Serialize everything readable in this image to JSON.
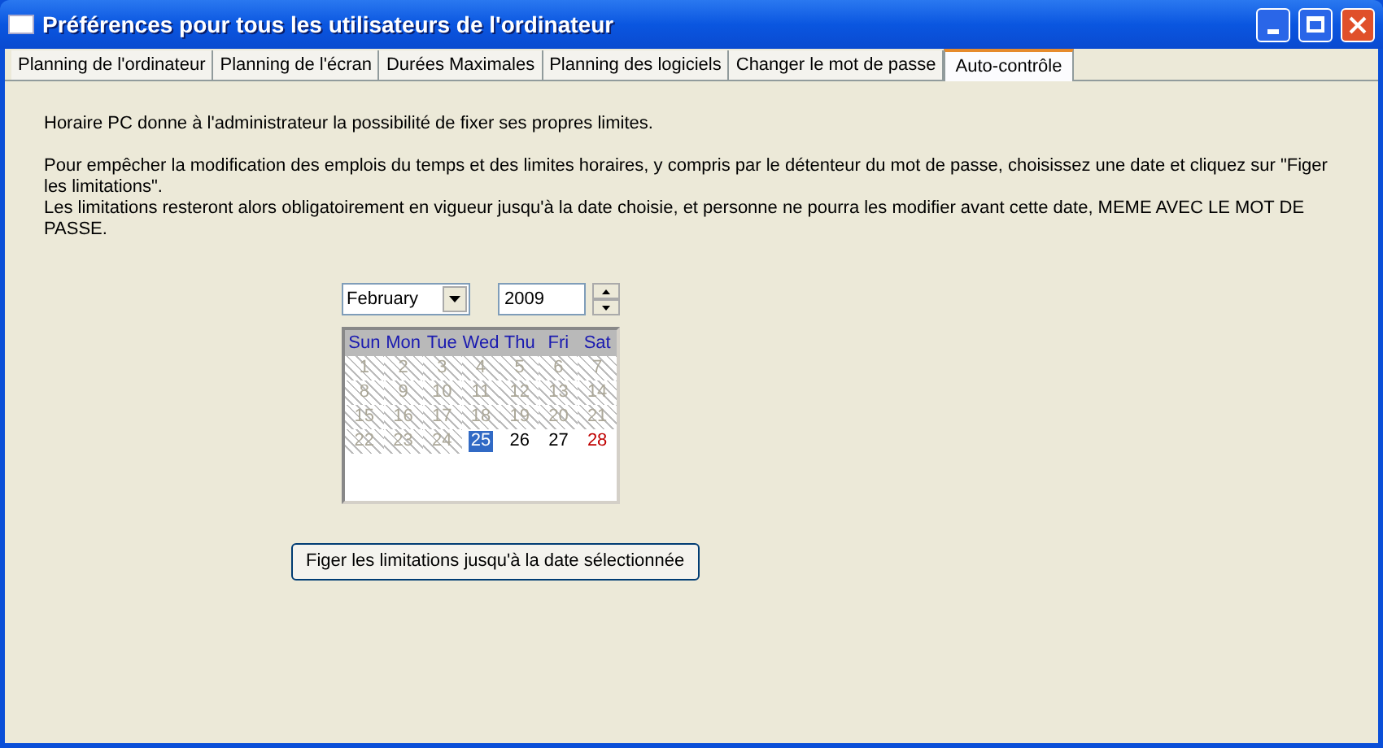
{
  "window": {
    "title": "Préférences pour tous les utilisateurs de l'ordinateur"
  },
  "tabs": [
    {
      "label": "Planning de l'ordinateur",
      "selected": false
    },
    {
      "label": "Planning de l'écran",
      "selected": false
    },
    {
      "label": "Durées Maximales",
      "selected": false
    },
    {
      "label": "Planning des logiciels",
      "selected": false
    },
    {
      "label": "Changer le mot de passe",
      "selected": false
    },
    {
      "label": "Auto-contrôle",
      "selected": true
    }
  ],
  "intro": "Horaire PC donne à l'administrateur la possibilité de fixer ses propres limites.",
  "paragraphs": [
    "Pour empêcher la modification des emplois du temps et des limites horaires, y compris par le détenteur du mot de passe, choisissez une date et cliquez sur \"Figer les limitations\".",
    "Les limitations resteront alors obligatoirement en vigueur jusqu'à la date choisie, et personne ne pourra les modifier avant cette date, MEME AVEC LE MOT DE PASSE."
  ],
  "month_select": {
    "value": "February"
  },
  "year_field": {
    "value": "2009"
  },
  "calendar": {
    "weekdays": [
      "Sun",
      "Mon",
      "Tue",
      "Wed",
      "Thu",
      "Fri",
      "Sat"
    ],
    "weeks": [
      [
        {
          "day": "1",
          "kind": "disabled"
        },
        {
          "day": "2",
          "kind": "disabled"
        },
        {
          "day": "3",
          "kind": "disabled"
        },
        {
          "day": "4",
          "kind": "disabled"
        },
        {
          "day": "5",
          "kind": "disabled"
        },
        {
          "day": "6",
          "kind": "disabled"
        },
        {
          "day": "7",
          "kind": "disabled"
        }
      ],
      [
        {
          "day": "8",
          "kind": "disabled"
        },
        {
          "day": "9",
          "kind": "disabled"
        },
        {
          "day": "10",
          "kind": "disabled"
        },
        {
          "day": "11",
          "kind": "disabled"
        },
        {
          "day": "12",
          "kind": "disabled"
        },
        {
          "day": "13",
          "kind": "disabled"
        },
        {
          "day": "14",
          "kind": "disabled"
        }
      ],
      [
        {
          "day": "15",
          "kind": "disabled"
        },
        {
          "day": "16",
          "kind": "disabled"
        },
        {
          "day": "17",
          "kind": "disabled"
        },
        {
          "day": "18",
          "kind": "disabled"
        },
        {
          "day": "19",
          "kind": "disabled"
        },
        {
          "day": "20",
          "kind": "disabled"
        },
        {
          "day": "21",
          "kind": "disabled"
        }
      ],
      [
        {
          "day": "22",
          "kind": "disabled"
        },
        {
          "day": "23",
          "kind": "disabled"
        },
        {
          "day": "24",
          "kind": "disabled"
        },
        {
          "day": "25",
          "kind": "selected"
        },
        {
          "day": "26",
          "kind": "normal"
        },
        {
          "day": "27",
          "kind": "normal"
        },
        {
          "day": "28",
          "kind": "marked"
        }
      ]
    ]
  },
  "freeze_button": {
    "label": "Figer les limitations jusqu'à la date sélectionnée"
  }
}
